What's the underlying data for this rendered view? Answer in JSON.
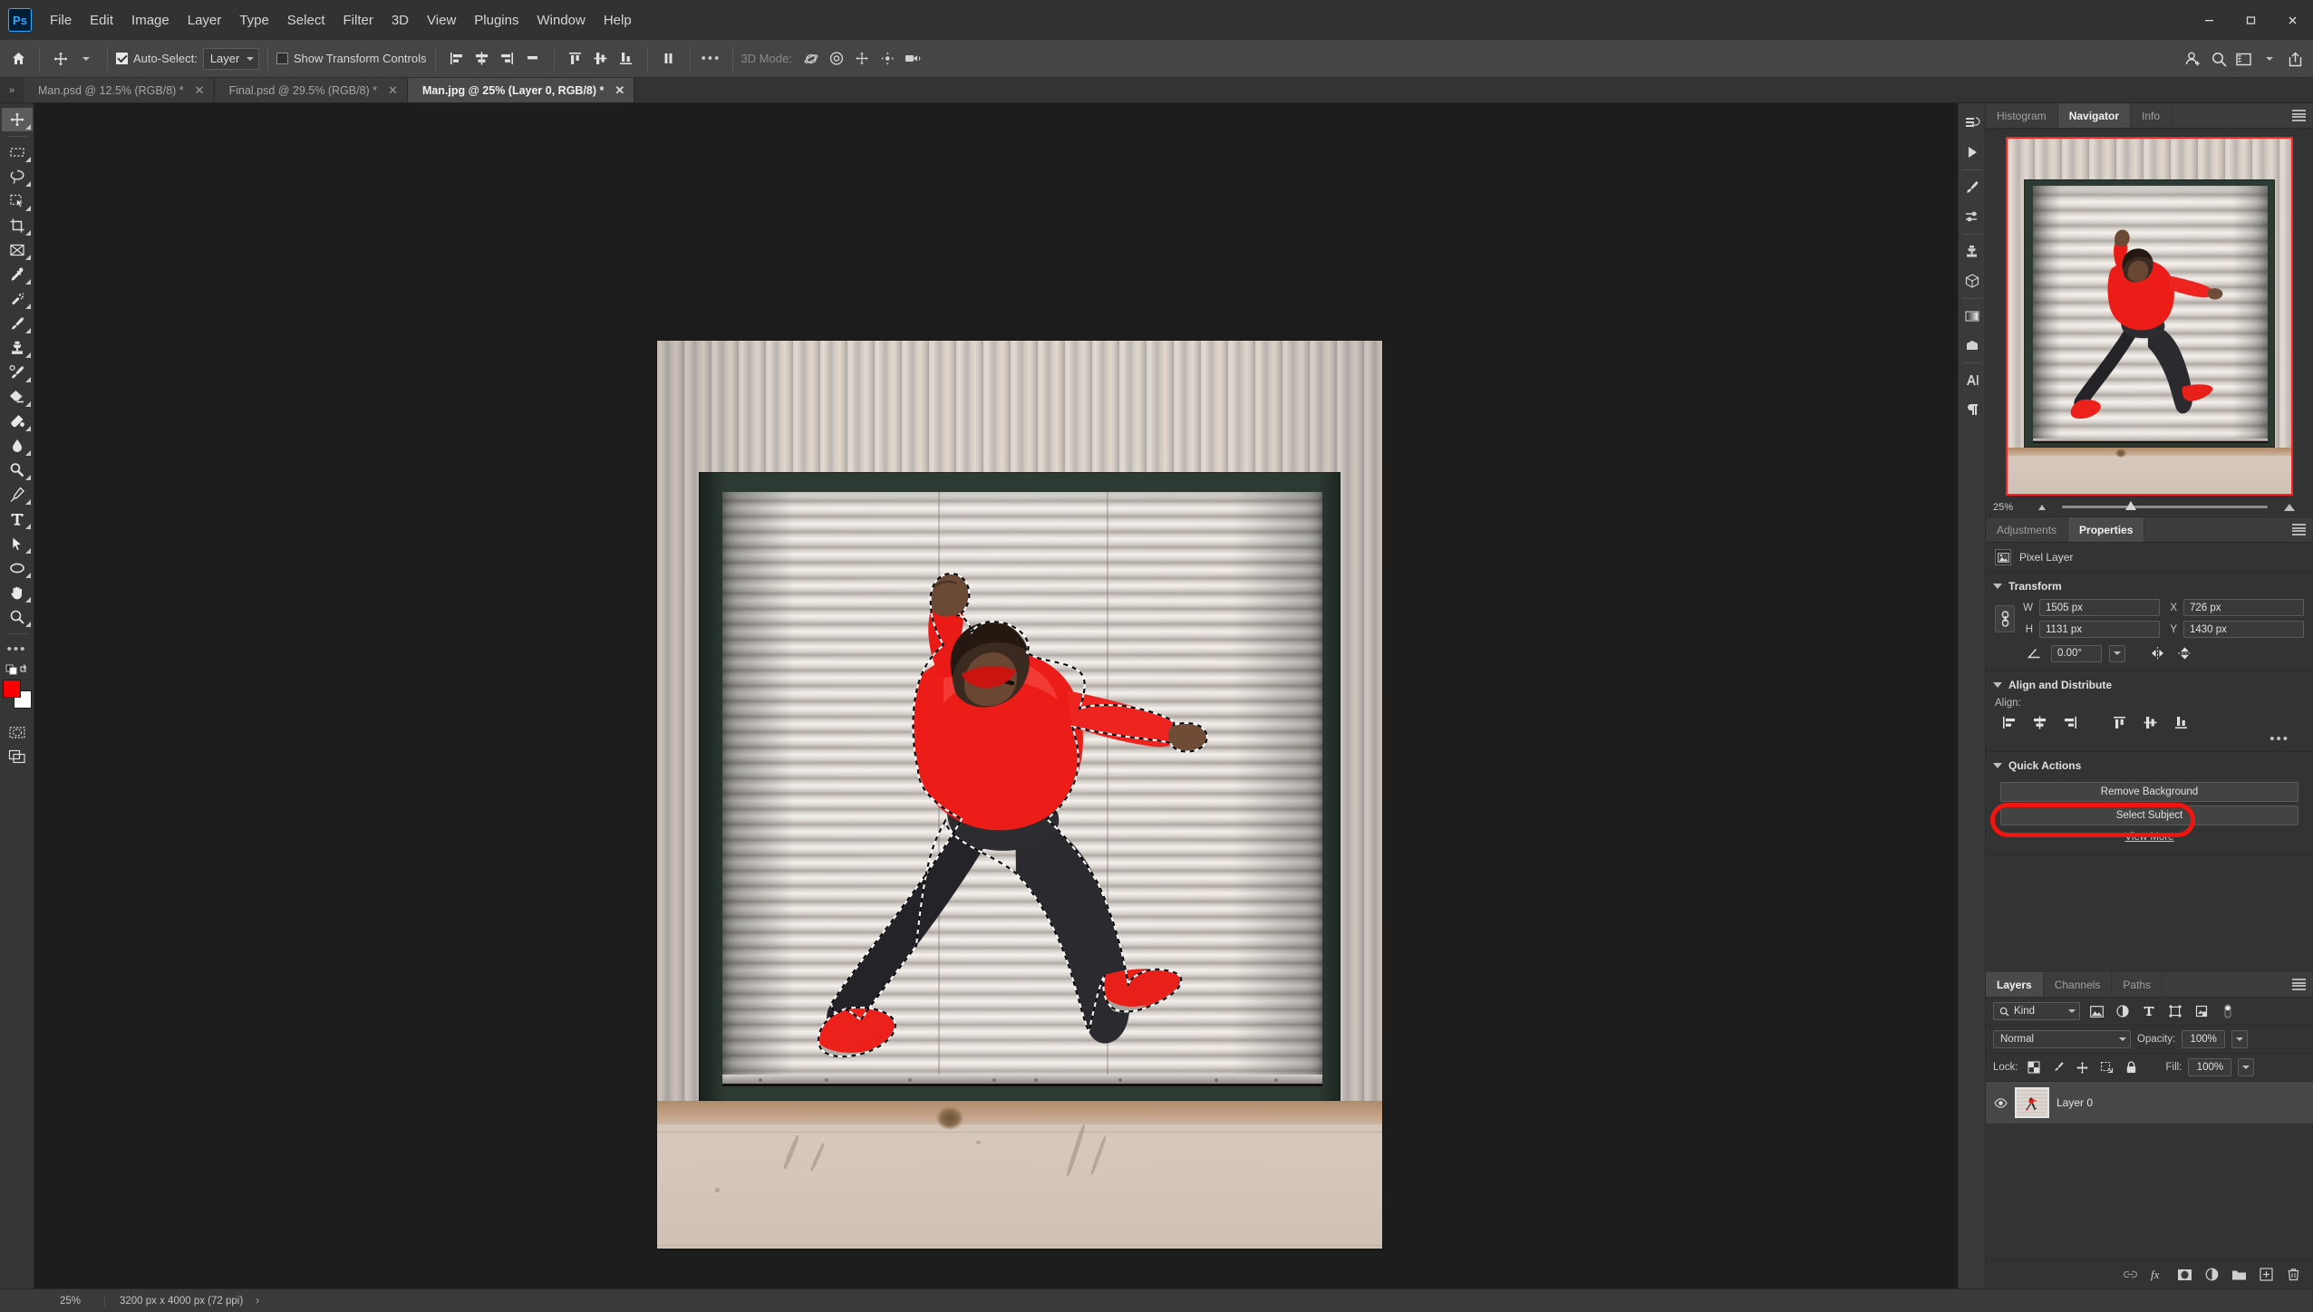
{
  "app": {
    "logo": "Ps",
    "menus": [
      "File",
      "Edit",
      "Image",
      "Layer",
      "Type",
      "Select",
      "Filter",
      "3D",
      "View",
      "Plugins",
      "Window",
      "Help"
    ],
    "window_controls": {
      "minimize": "—",
      "maximize": "▭",
      "close": "✕"
    },
    "top_right_icons": [
      "add-user-icon",
      "search-icon",
      "workspace-icon",
      "chevron-down-icon",
      "share-icon"
    ]
  },
  "options_bar": {
    "home_icon": "home-icon",
    "tool_icon": "move-tool-icon",
    "auto_select_label": "Auto-Select:",
    "auto_select_checked": true,
    "auto_select_scope": "Layer",
    "show_transform_label": "Show Transform Controls",
    "show_transform_checked": false,
    "align_icons": [
      "align-left-edges",
      "align-horizontal-centers",
      "align-right-edges",
      "distribute-horizontally"
    ],
    "align_icons2": [
      "align-top-edges",
      "align-vertical-centers",
      "align-bottom-edges",
      "distribute-vertically"
    ],
    "more_label": "•••",
    "mode_3d_label": "3D Mode:",
    "mode_3d_icons": [
      "orbit-3d-icon",
      "roll-3d-icon",
      "pan-3d-icon",
      "slide-3d-icon",
      "zoom-3d-icon"
    ]
  },
  "tabs": {
    "chevron": "»",
    "items": [
      {
        "title": "Man.psd @ 12.5% (RGB/8) *",
        "active": false,
        "close": "✕"
      },
      {
        "title": "Final.psd @ 29.5% (RGB/8) *",
        "active": false,
        "close": "✕"
      },
      {
        "title": "Man.jpg @ 25% (Layer 0, RGB/8) *",
        "active": true,
        "close": "✕"
      }
    ]
  },
  "toolbar": {
    "tools": [
      {
        "name": "move-tool",
        "active": true
      },
      {
        "name": "rectangular-marquee-tool",
        "active": false
      },
      {
        "name": "lasso-tool",
        "active": false
      },
      {
        "name": "object-selection-tool",
        "active": false
      },
      {
        "name": "crop-tool",
        "active": false
      },
      {
        "name": "frame-tool",
        "active": false
      },
      {
        "name": "eyedropper-tool",
        "active": false
      },
      {
        "name": "spot-healing-brush-tool",
        "active": false
      },
      {
        "name": "brush-tool",
        "active": false
      },
      {
        "name": "clone-stamp-tool",
        "active": false
      },
      {
        "name": "history-brush-tool",
        "active": false
      },
      {
        "name": "eraser-tool",
        "active": false
      },
      {
        "name": "gradient-tool",
        "active": false
      },
      {
        "name": "blur-tool",
        "active": false
      },
      {
        "name": "dodge-tool",
        "active": false
      },
      {
        "name": "pen-tool",
        "active": false
      },
      {
        "name": "type-tool",
        "active": false
      },
      {
        "name": "path-selection-tool",
        "active": false
      },
      {
        "name": "ellipse-shape-tool",
        "active": false
      },
      {
        "name": "hand-tool",
        "active": false
      },
      {
        "name": "zoom-tool",
        "active": false
      },
      {
        "name": "edit-toolbar-tool",
        "active": false
      }
    ],
    "foreground_color": "#fa0000",
    "background_color": "#ffffff",
    "quick_mask": "quick-mask-icon",
    "screen_mode": "screen-mode-icon"
  },
  "right_rail": {
    "icons": [
      "history-icon",
      "actions-icon",
      "brushes-icon",
      "brush-settings-icon",
      "clone-source-icon",
      "3d-icon",
      "gradients-icon",
      "patterns-icon",
      "character-icon",
      "paragraph-icon"
    ]
  },
  "navigator_panel": {
    "tabs": [
      {
        "label": "Histogram",
        "active": false
      },
      {
        "label": "Navigator",
        "active": true
      },
      {
        "label": "Info",
        "active": false
      }
    ],
    "menu_icon": "panel-menu-icon",
    "zoom_level": "25%",
    "zoom_out_icon": "zoom-out-icon",
    "zoom_in_icon": "zoom-in-icon",
    "slider_position_pct": 31
  },
  "properties_panel": {
    "tabs": [
      {
        "label": "Adjustments",
        "active": false
      },
      {
        "label": "Properties",
        "active": true
      }
    ],
    "menu_icon": "panel-menu-icon",
    "layer_type": "Pixel Layer",
    "layer_type_icon": "pixel-layer-icon",
    "transform": {
      "section_title": "Transform",
      "link_icon": "link-aspect-ratio-icon",
      "w_label": "W",
      "w_value": "1505 px",
      "h_label": "H",
      "h_value": "1131 px",
      "x_label": "X",
      "x_value": "726 px",
      "y_label": "Y",
      "y_value": "1430 px",
      "angle_icon": "angle-icon",
      "angle_value": "0.00°",
      "flip_horizontal_icon": "flip-horizontal-icon",
      "flip_vertical_icon": "flip-vertical-icon"
    },
    "align": {
      "section_title": "Align and Distribute",
      "align_label": "Align:",
      "buttons": [
        "align-left-edges",
        "align-horizontal-centers",
        "align-right-edges",
        "align-top-edges",
        "align-vertical-centers",
        "align-bottom-edges"
      ],
      "more_label": "•••"
    },
    "quick_actions": {
      "section_title": "Quick Actions",
      "remove_background": "Remove Background",
      "select_subject": "Select Subject",
      "select_subject_highlighted": true,
      "highlight_color": "#f1150f",
      "view_more": "View More"
    }
  },
  "layers_panel": {
    "tabs": [
      {
        "label": "Layers",
        "active": true
      },
      {
        "label": "Channels",
        "active": false
      },
      {
        "label": "Paths",
        "active": false
      }
    ],
    "menu_icon": "panel-menu-icon",
    "filter_kind": "Kind",
    "filter_search_icon": "search-icon",
    "filter_icons": [
      "filter-pixel-icon",
      "filter-adjustment-icon",
      "filter-type-icon",
      "filter-shape-icon",
      "filter-smart-object-icon"
    ],
    "filter_toggle_icon": "filter-toggle-icon",
    "blend_mode": "Normal",
    "opacity_label": "Opacity:",
    "opacity_value": "100%",
    "lock_label": "Lock:",
    "lock_icons": [
      "lock-transparent-pixels-icon",
      "lock-image-pixels-icon",
      "lock-position-icon",
      "lock-artboard-nesting-icon",
      "lock-all-icon"
    ],
    "fill_label": "Fill:",
    "fill_value": "100%",
    "layers": [
      {
        "name": "Layer 0",
        "visible": true,
        "visibility_icon": "eye-icon",
        "selected": true
      }
    ],
    "footer_icons": [
      "link-layers-icon",
      "layer-styles-fx-icon",
      "add-layer-mask-icon",
      "new-adjustment-layer-icon",
      "new-group-icon",
      "new-layer-icon",
      "delete-layer-icon"
    ]
  },
  "status_bar": {
    "zoom": "25%",
    "doc_size": "3200 px x 4000 px (72 ppi)",
    "arrow": "›"
  },
  "canvas": {
    "document_name": "Man.jpg",
    "selection_active": true,
    "subject_description": "man-jumping-in-red-hoodie",
    "background_description": "industrial-roller-shutter-door"
  }
}
